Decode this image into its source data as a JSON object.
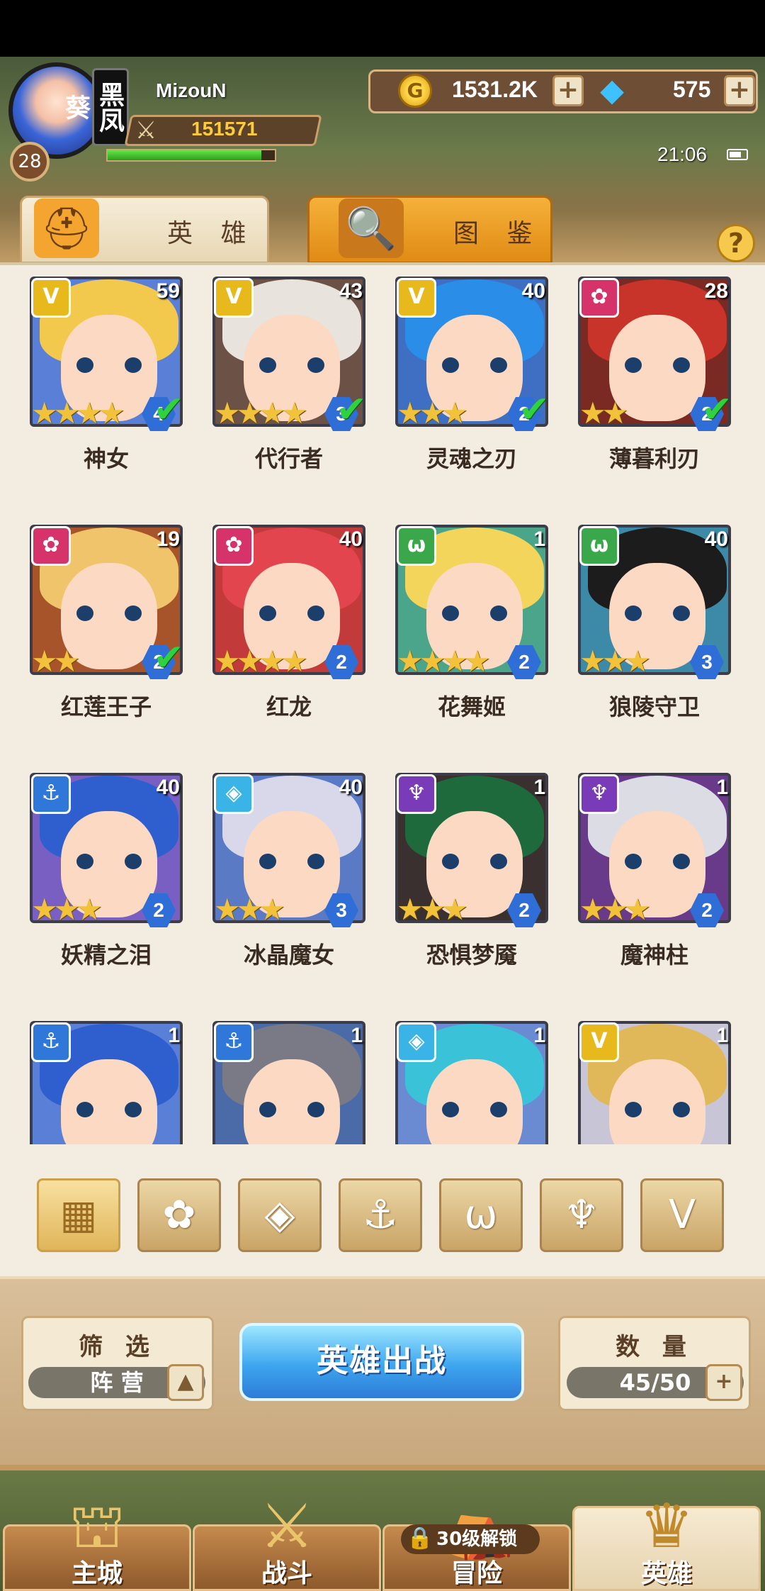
{
  "player": {
    "name": "MizouN",
    "level": "28",
    "guild": "黑凤葵",
    "power": "151571",
    "xp_fraction": 0.92
  },
  "resources": {
    "gold": "1531.2K",
    "gems": "575"
  },
  "status": {
    "time": "21:06"
  },
  "tabs": [
    {
      "label": "英 雄",
      "icon": "helmet-icon"
    },
    {
      "label": "图 鉴",
      "icon": "magnifier-icon"
    }
  ],
  "help_label": "?",
  "heroes": [
    {
      "name": "神女",
      "level": "59",
      "stars": "★★★★",
      "rank": "4",
      "owned": true,
      "faction": "light",
      "faction_glyph": "V",
      "faction_color": "#e8b91c",
      "hair": "#f2c94c",
      "bg": "#5a7fd6"
    },
    {
      "name": "代行者",
      "level": "43",
      "stars": "★★★★",
      "rank": "3",
      "owned": true,
      "faction": "light",
      "faction_glyph": "V",
      "faction_color": "#e8b91c",
      "hair": "#e8e3dc",
      "bg": "#6b5146"
    },
    {
      "name": "灵魂之刃",
      "level": "40",
      "stars": "★★★",
      "rank": "2",
      "owned": true,
      "faction": "light",
      "faction_glyph": "V",
      "faction_color": "#e8b91c",
      "hair": "#2a8de8",
      "bg": "#3f6fc2"
    },
    {
      "name": "薄暮利刃",
      "level": "28",
      "stars": "★★",
      "rank": "2",
      "owned": true,
      "faction": "fire",
      "faction_glyph": "✿",
      "faction_color": "#d6336b",
      "hair": "#c8342a",
      "bg": "#7a2a22"
    },
    {
      "name": "红莲王子",
      "level": "19",
      "stars": "★★",
      "rank": "2",
      "owned": true,
      "faction": "fire",
      "faction_glyph": "✿",
      "faction_color": "#d6336b",
      "hair": "#f0c46a",
      "bg": "#a8542a"
    },
    {
      "name": "红龙",
      "level": "40",
      "stars": "★★★★",
      "rank": "2",
      "owned": false,
      "faction": "fire",
      "faction_glyph": "✿",
      "faction_color": "#d6336b",
      "hair": "#e2454d",
      "bg": "#c23a3a"
    },
    {
      "name": "花舞姬",
      "level": "1",
      "stars": "★★★★",
      "rank": "2",
      "owned": false,
      "faction": "beast",
      "faction_glyph": "ω",
      "faction_color": "#3aa84a",
      "hair": "#f2d55a",
      "bg": "#4aa58a"
    },
    {
      "name": "狼陵守卫",
      "level": "40",
      "stars": "★★★",
      "rank": "3",
      "owned": false,
      "faction": "beast",
      "faction_glyph": "ω",
      "faction_color": "#3aa84a",
      "hair": "#1c1c1c",
      "bg": "#3c8aa8"
    },
    {
      "name": "妖精之泪",
      "level": "40",
      "stars": "★★★",
      "rank": "2",
      "owned": false,
      "faction": "water",
      "faction_glyph": "⚓",
      "faction_color": "#2f77d8",
      "hair": "#2f5fcf",
      "bg": "#7a5fc2"
    },
    {
      "name": "冰晶魔女",
      "level": "40",
      "stars": "★★★",
      "rank": "3",
      "owned": false,
      "faction": "ice",
      "faction_glyph": "◈",
      "faction_color": "#3ab4e6",
      "hair": "#d8d8ea",
      "bg": "#5a7ac6"
    },
    {
      "name": "恐惧梦魇",
      "level": "1",
      "stars": "★★★",
      "rank": "2",
      "owned": false,
      "faction": "dark",
      "faction_glyph": "♆",
      "faction_color": "#7a3bb8",
      "hair": "#1f6a3c",
      "bg": "#3a3030"
    },
    {
      "name": "魔神柱",
      "level": "1",
      "stars": "★★★",
      "rank": "2",
      "owned": false,
      "faction": "dark",
      "faction_glyph": "♆",
      "faction_color": "#7a3bb8",
      "hair": "#dcdce4",
      "bg": "#6a3a8a"
    },
    {
      "name": "",
      "level": "1",
      "stars": "",
      "rank": "",
      "owned": false,
      "faction": "water",
      "faction_glyph": "⚓",
      "faction_color": "#2f77d8",
      "hair": "#2f5fcf",
      "bg": "#5a7fd6"
    },
    {
      "name": "",
      "level": "1",
      "stars": "",
      "rank": "",
      "owned": false,
      "faction": "water",
      "faction_glyph": "⚓",
      "faction_color": "#2f77d8",
      "hair": "#7a7a86",
      "bg": "#4a6aa8"
    },
    {
      "name": "",
      "level": "1",
      "stars": "",
      "rank": "",
      "owned": false,
      "faction": "ice",
      "faction_glyph": "◈",
      "faction_color": "#3ab4e6",
      "hair": "#3ac2d8",
      "bg": "#6a8ad2"
    },
    {
      "name": "",
      "level": "1",
      "stars": "",
      "rank": "",
      "owned": false,
      "faction": "light",
      "faction_glyph": "V",
      "faction_color": "#e8b91c",
      "hair": "#e0b85a",
      "bg": "#c8c6d6"
    }
  ],
  "faction_filters": [
    {
      "icon": "all-grid-icon",
      "glyph": "▦",
      "active": true
    },
    {
      "icon": "fire-faction-icon",
      "glyph": "✿",
      "active": false
    },
    {
      "icon": "ice-faction-icon",
      "glyph": "◈",
      "active": false
    },
    {
      "icon": "water-faction-icon",
      "glyph": "⚓",
      "active": false
    },
    {
      "icon": "beast-faction-icon",
      "glyph": "ω",
      "active": false
    },
    {
      "icon": "dark-faction-icon",
      "glyph": "♆",
      "active": false
    },
    {
      "icon": "light-faction-icon",
      "glyph": "V",
      "active": false
    }
  ],
  "filter": {
    "title": "筛 选",
    "value": "阵 营",
    "toggle": "▲"
  },
  "deploy_button": "英雄出战",
  "count": {
    "title": "数 量",
    "value": "45/50",
    "plus": "+"
  },
  "nav": [
    {
      "label": "主城",
      "icon": "castle-icon",
      "glyph": "⛫",
      "active": false
    },
    {
      "label": "战斗",
      "icon": "crossed-swords-icon",
      "glyph": "⚔",
      "active": false
    },
    {
      "label": "冒险",
      "icon": "adventure-icon",
      "glyph": "⛺",
      "active": false,
      "lock": "30级解锁"
    },
    {
      "label": "英雄",
      "icon": "hero-helmet-icon",
      "glyph": "♛",
      "active": true
    }
  ]
}
